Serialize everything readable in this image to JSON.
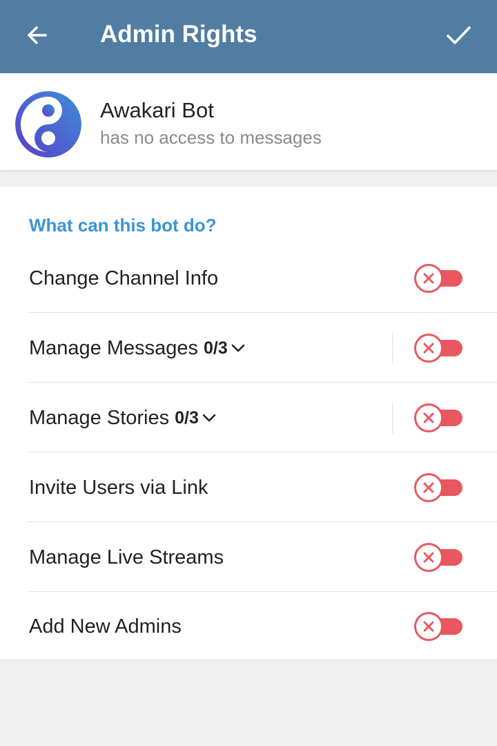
{
  "appbar": {
    "title": "Admin Rights",
    "back_icon": "arrow-left-icon",
    "done_icon": "checkmark-icon",
    "background_color": "#517da2"
  },
  "bot": {
    "name": "Awakari Bot",
    "status": "has no access to messages",
    "avatar_colors": [
      "#5b3ec8",
      "#3d8fd8"
    ]
  },
  "rights": {
    "header": "What can this bot do?",
    "header_color": "#3a95d5",
    "toggle_color": "#e8585e",
    "items": [
      {
        "label": "Change Channel Info",
        "count": "",
        "expandable": false,
        "enabled": false
      },
      {
        "label": "Manage Messages",
        "count": "0/3",
        "expandable": true,
        "enabled": false
      },
      {
        "label": "Manage Stories",
        "count": "0/3",
        "expandable": true,
        "enabled": false
      },
      {
        "label": "Invite Users via Link",
        "count": "",
        "expandable": false,
        "enabled": false
      },
      {
        "label": "Manage Live Streams",
        "count": "",
        "expandable": false,
        "enabled": false
      },
      {
        "label": "Add New Admins",
        "count": "",
        "expandable": false,
        "enabled": false
      }
    ]
  }
}
